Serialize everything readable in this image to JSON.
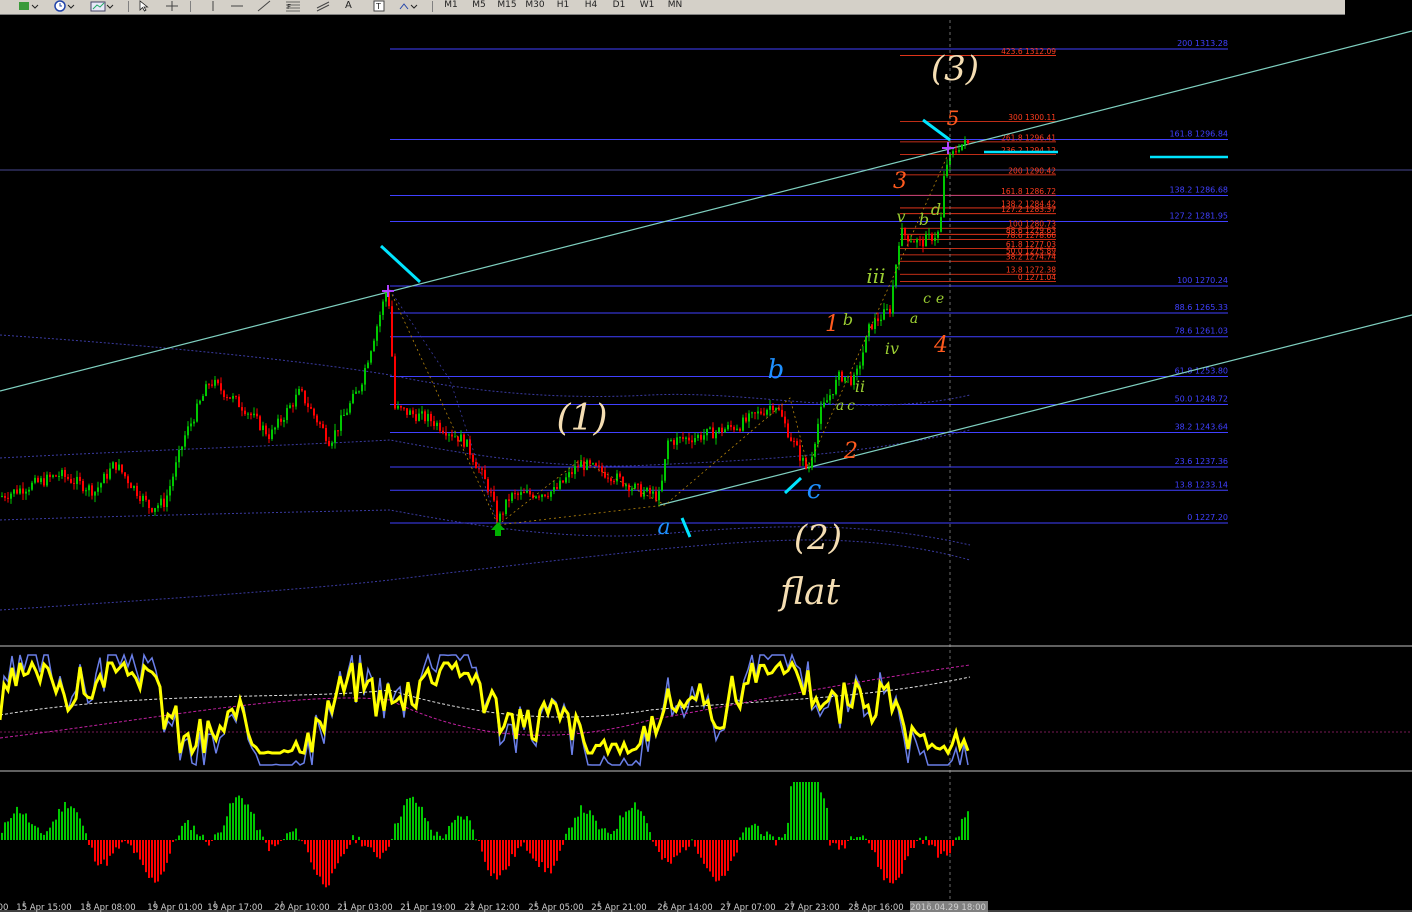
{
  "toolbar": {
    "timeframes": [
      "M1",
      "M5",
      "M15",
      "M30",
      "H1",
      "H4",
      "D1",
      "W1",
      "MN"
    ],
    "icons": [
      "new-order-icon",
      "clock-icon",
      "chart-template-icon",
      "cursor-icon",
      "crosshair-icon",
      "horizontal-line-icon",
      "trendline-icon",
      "fibonacci-icon",
      "text-icon",
      "label-icon",
      "arrows-icon"
    ],
    "tool_labels": {
      "text": "A",
      "label": "T"
    }
  },
  "chart_data": {
    "type": "candlestick",
    "grid": false,
    "time_labels": [
      "00",
      "15 Apr 15:00",
      "18 Apr 08:00",
      "19 Apr 01:00",
      "19 Apr 17:00",
      "20 Apr 10:00",
      "21 Apr 03:00",
      "21 Apr 19:00",
      "22 Apr 12:00",
      "25 Apr 05:00",
      "25 Apr 21:00",
      "26 Apr 14:00",
      "27 Apr 07:00",
      "27 Apr 23:00",
      "28 Apr 16:00",
      "2016.04.29 18:00"
    ],
    "fib_levels_main": [
      {
        "ratio": "200",
        "price": 1313.28
      },
      {
        "ratio": "161.8",
        "price": 1296.84
      },
      {
        "ratio": "138.2",
        "price": 1286.68
      },
      {
        "ratio": "127.2",
        "price": 1281.95
      },
      {
        "ratio": "100",
        "price": 1270.24
      },
      {
        "ratio": "88.6",
        "price": 1265.33
      },
      {
        "ratio": "78.6",
        "price": 1261.03
      },
      {
        "ratio": "61.8",
        "price": 1253.8
      },
      {
        "ratio": "50.0",
        "price": 1248.72
      },
      {
        "ratio": "38.2",
        "price": 1243.64
      },
      {
        "ratio": "23.6",
        "price": 1237.36
      },
      {
        "ratio": "13.8",
        "price": 1233.14
      },
      {
        "ratio": "0",
        "price": 1227.2
      }
    ],
    "fib_levels_ext": [
      {
        "ratio": "423.6",
        "price": 1312.09
      },
      {
        "ratio": "300",
        "price": 1300.11
      },
      {
        "ratio": "261.8",
        "price": 1296.41
      },
      {
        "ratio": "236.2",
        "price": 1294.12
      },
      {
        "ratio": "200",
        "price": 1290.42
      },
      {
        "ratio": "161.8",
        "price": 1286.72
      },
      {
        "ratio": "138.2",
        "price": 1284.42
      },
      {
        "ratio": "127.2",
        "price": 1283.37
      },
      {
        "ratio": "100",
        "price": 1280.73
      },
      {
        "ratio": "88.6",
        "price": 1279.63
      },
      {
        "ratio": "78.6",
        "price": 1278.66
      },
      {
        "ratio": "61.8",
        "price": 1277.03
      },
      {
        "ratio": "50.0",
        "price": 1275.89
      },
      {
        "ratio": "38.2",
        "price": 1274.74
      },
      {
        "ratio": "13.8",
        "price": 1272.38
      },
      {
        "ratio": "0",
        "price": 1271.04
      }
    ],
    "wave_labels": [
      {
        "text": "(3)",
        "color": "#f5deb3"
      },
      {
        "text": "(1)",
        "color": "#f5deb3"
      },
      {
        "text": "(2)",
        "color": "#f5deb3"
      },
      {
        "text": "flat",
        "color": "#f5deb3"
      },
      {
        "text": "5",
        "color": "#ff5a1e"
      },
      {
        "text": "3",
        "color": "#ff5a1e"
      },
      {
        "text": "1",
        "color": "#ff5a1e"
      },
      {
        "text": "2",
        "color": "#ff5a1e"
      },
      {
        "text": "4",
        "color": "#ff5a1e"
      },
      {
        "text": "a",
        "color": "#1e90ff"
      },
      {
        "text": "b",
        "color": "#1e90ff"
      },
      {
        "text": "c",
        "color": "#1e90ff"
      },
      {
        "text": "iii",
        "color": "#9acd32"
      },
      {
        "text": "v",
        "color": "#9acd32"
      },
      {
        "text": "b",
        "color": "#9acd32"
      },
      {
        "text": "d",
        "color": "#9acd32"
      },
      {
        "text": "ii",
        "color": "#9acd32"
      },
      {
        "text": "iv",
        "color": "#9acd32"
      },
      {
        "text": "a",
        "color": "#9acd32"
      },
      {
        "text": "c",
        "color": "#9acd32"
      },
      {
        "text": "c",
        "color": "#9acd32"
      },
      {
        "text": "e",
        "color": "#9acd32"
      },
      {
        "text": "a",
        "color": "#9acd32"
      },
      {
        "text": "b",
        "color": "#9acd32"
      }
    ],
    "indicators": [
      "stochastic oscillator (yellow/blue, dashed signal lines)",
      "histogram oscillator (green/red bars)"
    ]
  },
  "colors": {
    "background": "#000000",
    "bull_candle": "#00c800",
    "bear_candle": "#ff0000",
    "fib_main": "#4040ff",
    "fib_ext": "#ff3c1e",
    "channel": "#7fd0c0",
    "cyan_marker": "#00e5ff"
  }
}
